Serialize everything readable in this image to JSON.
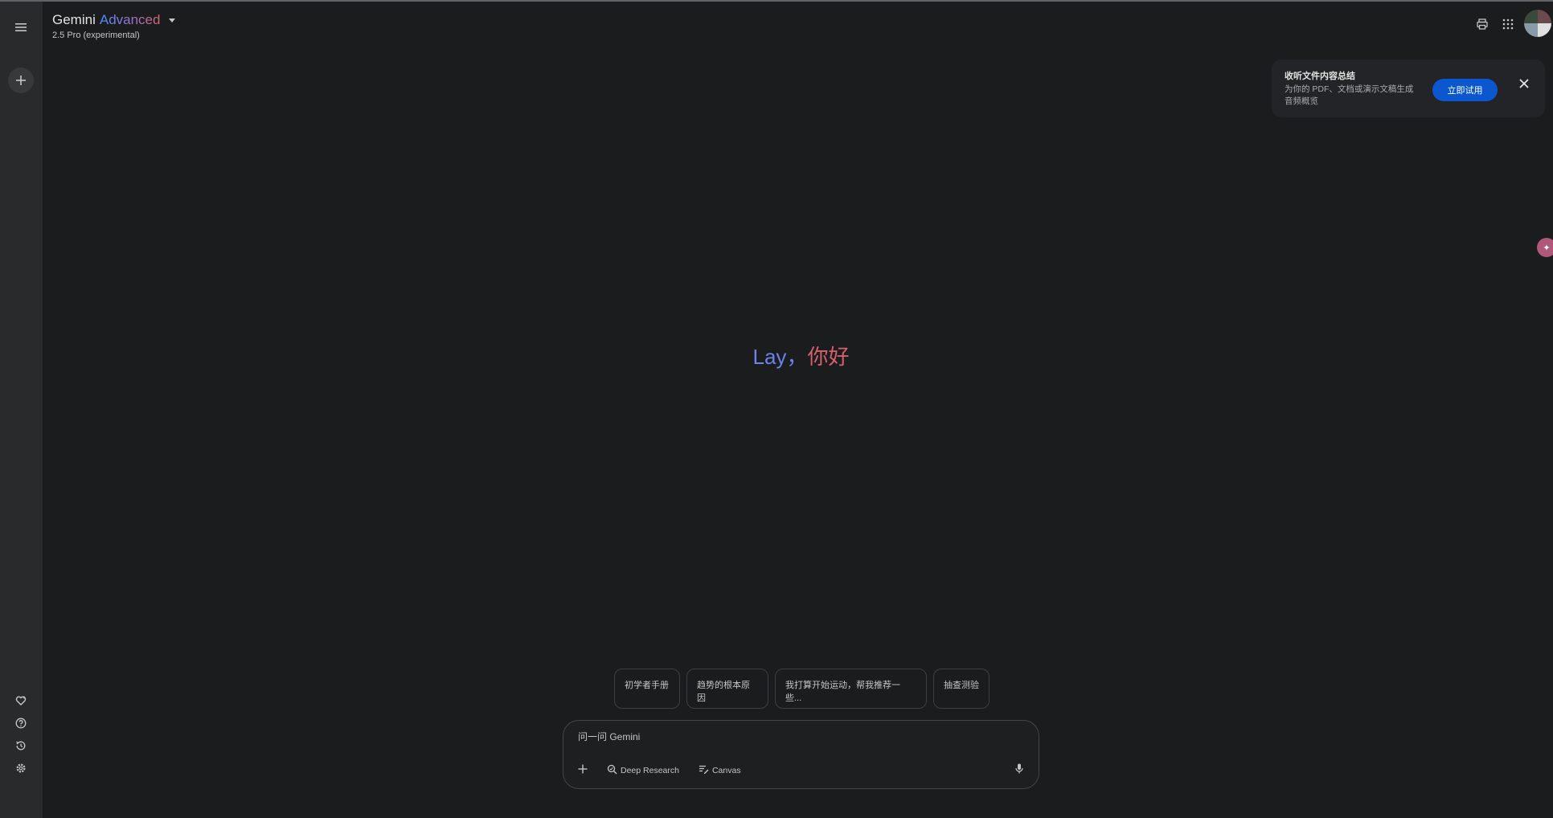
{
  "header": {
    "brand": "Gemini",
    "tier": "Advanced",
    "model": "2.5 Pro (experimental)"
  },
  "icons": {
    "menu": "menu-icon",
    "new_chat": "plus-icon",
    "gem": "gem-heart-icon",
    "help": "help-icon",
    "activity": "history-icon",
    "settings": "settings-icon",
    "print": "print-icon",
    "apps": "apps-grid-icon",
    "close": "close-icon",
    "mic": "mic-icon"
  },
  "promo": {
    "title": "收听文件内容总结",
    "description": "为你的 PDF、文档或演示文稿生成音频概览",
    "button": "立即试用"
  },
  "greeting": {
    "name": "Lay",
    "separator": "，",
    "hello": "你好"
  },
  "suggestions": [
    "初学者手册",
    "趋势的根本原因",
    "我打算开始运动，帮我推荐一些...",
    "抽查测验"
  ],
  "composer": {
    "placeholder": "问一问 Gemini",
    "tools": [
      "Deep Research",
      "Canvas"
    ]
  },
  "colors": {
    "background": "#1b1c1d",
    "rail": "#282a2c",
    "accent_blue": "#0b57d0",
    "greeting_name": "#6d82e8",
    "greeting_hello": "#d6606e"
  }
}
